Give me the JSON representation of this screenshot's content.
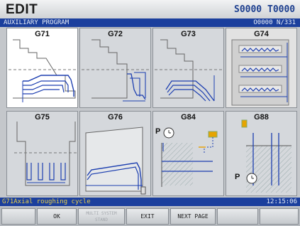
{
  "header": {
    "mode": "EDIT",
    "spindle": "S0000",
    "tool": "T0000"
  },
  "titlebar": {
    "title": "AUXILIARY PROGRAM",
    "program": "O0000 N/331"
  },
  "panels": [
    {
      "code": "G71",
      "selected": true
    },
    {
      "code": "G72"
    },
    {
      "code": "G73"
    },
    {
      "code": "G74"
    },
    {
      "code": "G75"
    },
    {
      "code": "G76"
    },
    {
      "code": "G84",
      "marker": "P"
    },
    {
      "code": "G88",
      "marker": "P"
    }
  ],
  "status": {
    "message": "G71Axial roughing cycle",
    "clock": "12:15:06"
  },
  "softkeys": [
    {
      "label": "",
      "enabled": false
    },
    {
      "label": "OK",
      "enabled": true
    },
    {
      "label": "MULTI SYSTEM STAND",
      "enabled": false
    },
    {
      "label": "EXIT",
      "enabled": true
    },
    {
      "label": "NEXT PAGE",
      "enabled": true
    },
    {
      "label": "",
      "enabled": false
    },
    {
      "label": "",
      "enabled": false
    }
  ],
  "colors": {
    "title_bar": "#1b3f9d",
    "path_blue": "#1d3fb0",
    "status_text": "#e9d04a",
    "selected_panel": "#ffffff"
  }
}
